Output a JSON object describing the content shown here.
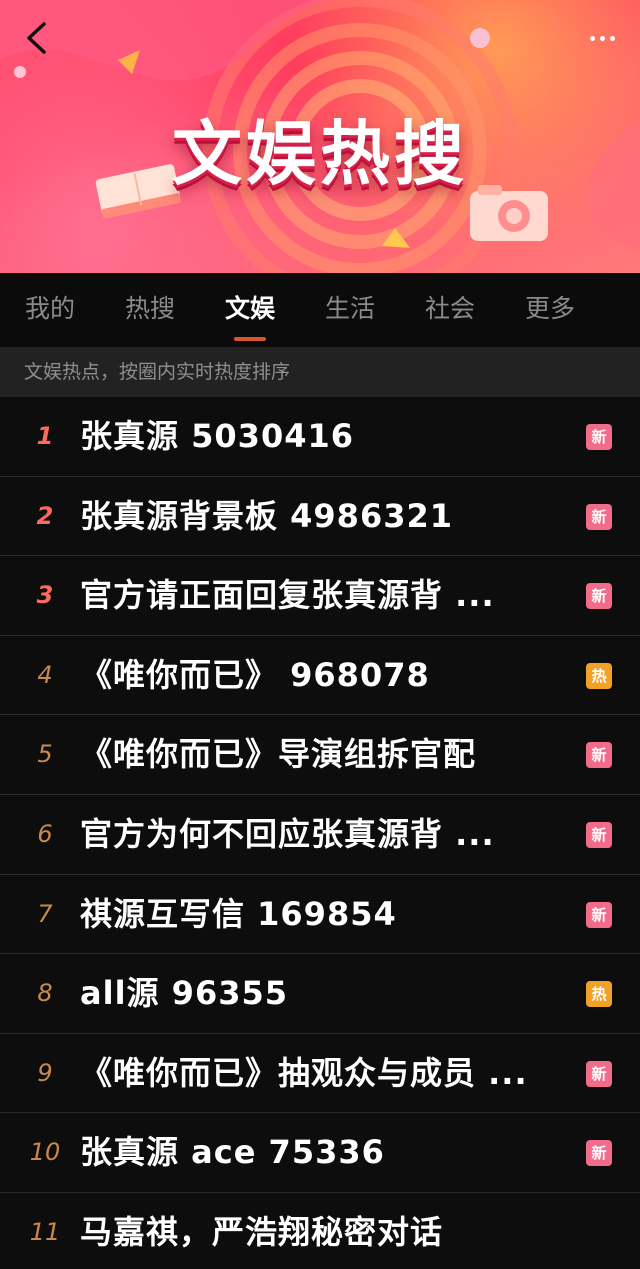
{
  "header": {
    "title": "文娱热搜",
    "back_icon": "chevron-left-icon",
    "more_icon": "more-dots-icon"
  },
  "tabs": [
    {
      "label": "我的",
      "active": false
    },
    {
      "label": "热搜",
      "active": false
    },
    {
      "label": "文娱",
      "active": true
    },
    {
      "label": "生活",
      "active": false
    },
    {
      "label": "社会",
      "active": false
    },
    {
      "label": "更多",
      "active": false
    }
  ],
  "subtitle": "文娱热点，按圈内实时热度排序",
  "colors": {
    "accent_tab_underline": "#d9552c",
    "rank_top": "#ff6a5e",
    "rank_rest": "#c8894e",
    "badge_new": "#f06c8a",
    "badge_hot": "#f1a126"
  },
  "items": [
    {
      "rank": "1",
      "title": "张真源 5030416",
      "badge": "新",
      "badge_type": "new"
    },
    {
      "rank": "2",
      "title": "张真源背景板 4986321",
      "badge": "新",
      "badge_type": "new"
    },
    {
      "rank": "3",
      "title": "官方请正面回复张真源背 ...",
      "badge": "新",
      "badge_type": "new"
    },
    {
      "rank": "4",
      "title": "《唯你而已》 968078",
      "badge": "热",
      "badge_type": "hot"
    },
    {
      "rank": "5",
      "title": "《唯你而已》导演组拆官配",
      "badge": "新",
      "badge_type": "new"
    },
    {
      "rank": "6",
      "title": "官方为何不回应张真源背 ...",
      "badge": "新",
      "badge_type": "new"
    },
    {
      "rank": "7",
      "title": "祺源互写信 169854",
      "badge": "新",
      "badge_type": "new"
    },
    {
      "rank": "8",
      "title": "all源 96355",
      "badge": "热",
      "badge_type": "hot"
    },
    {
      "rank": "9",
      "title": "《唯你而已》抽观众与成员 ...",
      "badge": "新",
      "badge_type": "new"
    },
    {
      "rank": "10",
      "title": "张真源 ace 75336",
      "badge": "新",
      "badge_type": "new"
    },
    {
      "rank": "11",
      "title": "马嘉祺，严浩翔秘密对话",
      "badge": "",
      "badge_type": ""
    }
  ]
}
